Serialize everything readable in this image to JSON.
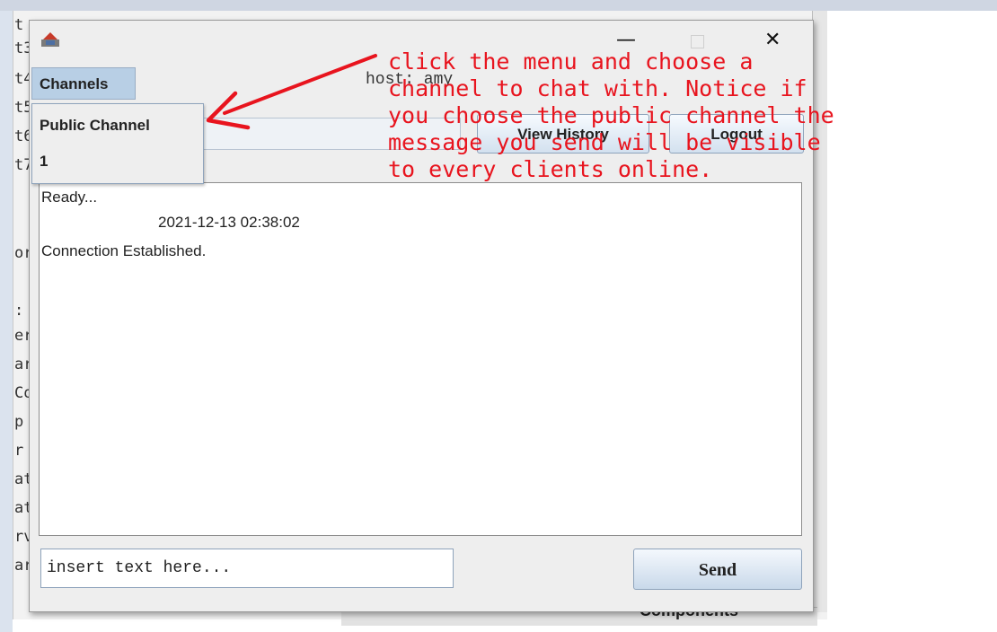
{
  "background": {
    "left_letters": [
      "t",
      "t3",
      "t4",
      "t5",
      "t6",
      "t7",
      "",
      "or",
      "",
      ":",
      "er",
      "ar",
      "Co",
      "p",
      "r",
      "at",
      "at",
      "rv",
      "ar"
    ],
    "panel_label": "Components"
  },
  "window": {
    "icon": "java-app-icon",
    "controls": {
      "minimize": "—",
      "maximize": "",
      "close": "✕"
    }
  },
  "menu": {
    "channels_label": "Channels",
    "items": [
      "Public Channel",
      "1"
    ]
  },
  "host_label": "host: amy",
  "buttons": {
    "history": "View History",
    "logout": "Logout",
    "send": "Send"
  },
  "chat": {
    "ready": "Ready...",
    "timestamp": "2021-12-13 02:38:02",
    "connection": "Connection Established."
  },
  "input": {
    "placeholder": "insert text here..."
  },
  "annotation": {
    "text": "click the menu and choose a\nchannel to chat with. Notice if\nyou choose the public channel the\nmessage you send will be visible\nto every clients online.",
    "color": "#e8141e"
  }
}
